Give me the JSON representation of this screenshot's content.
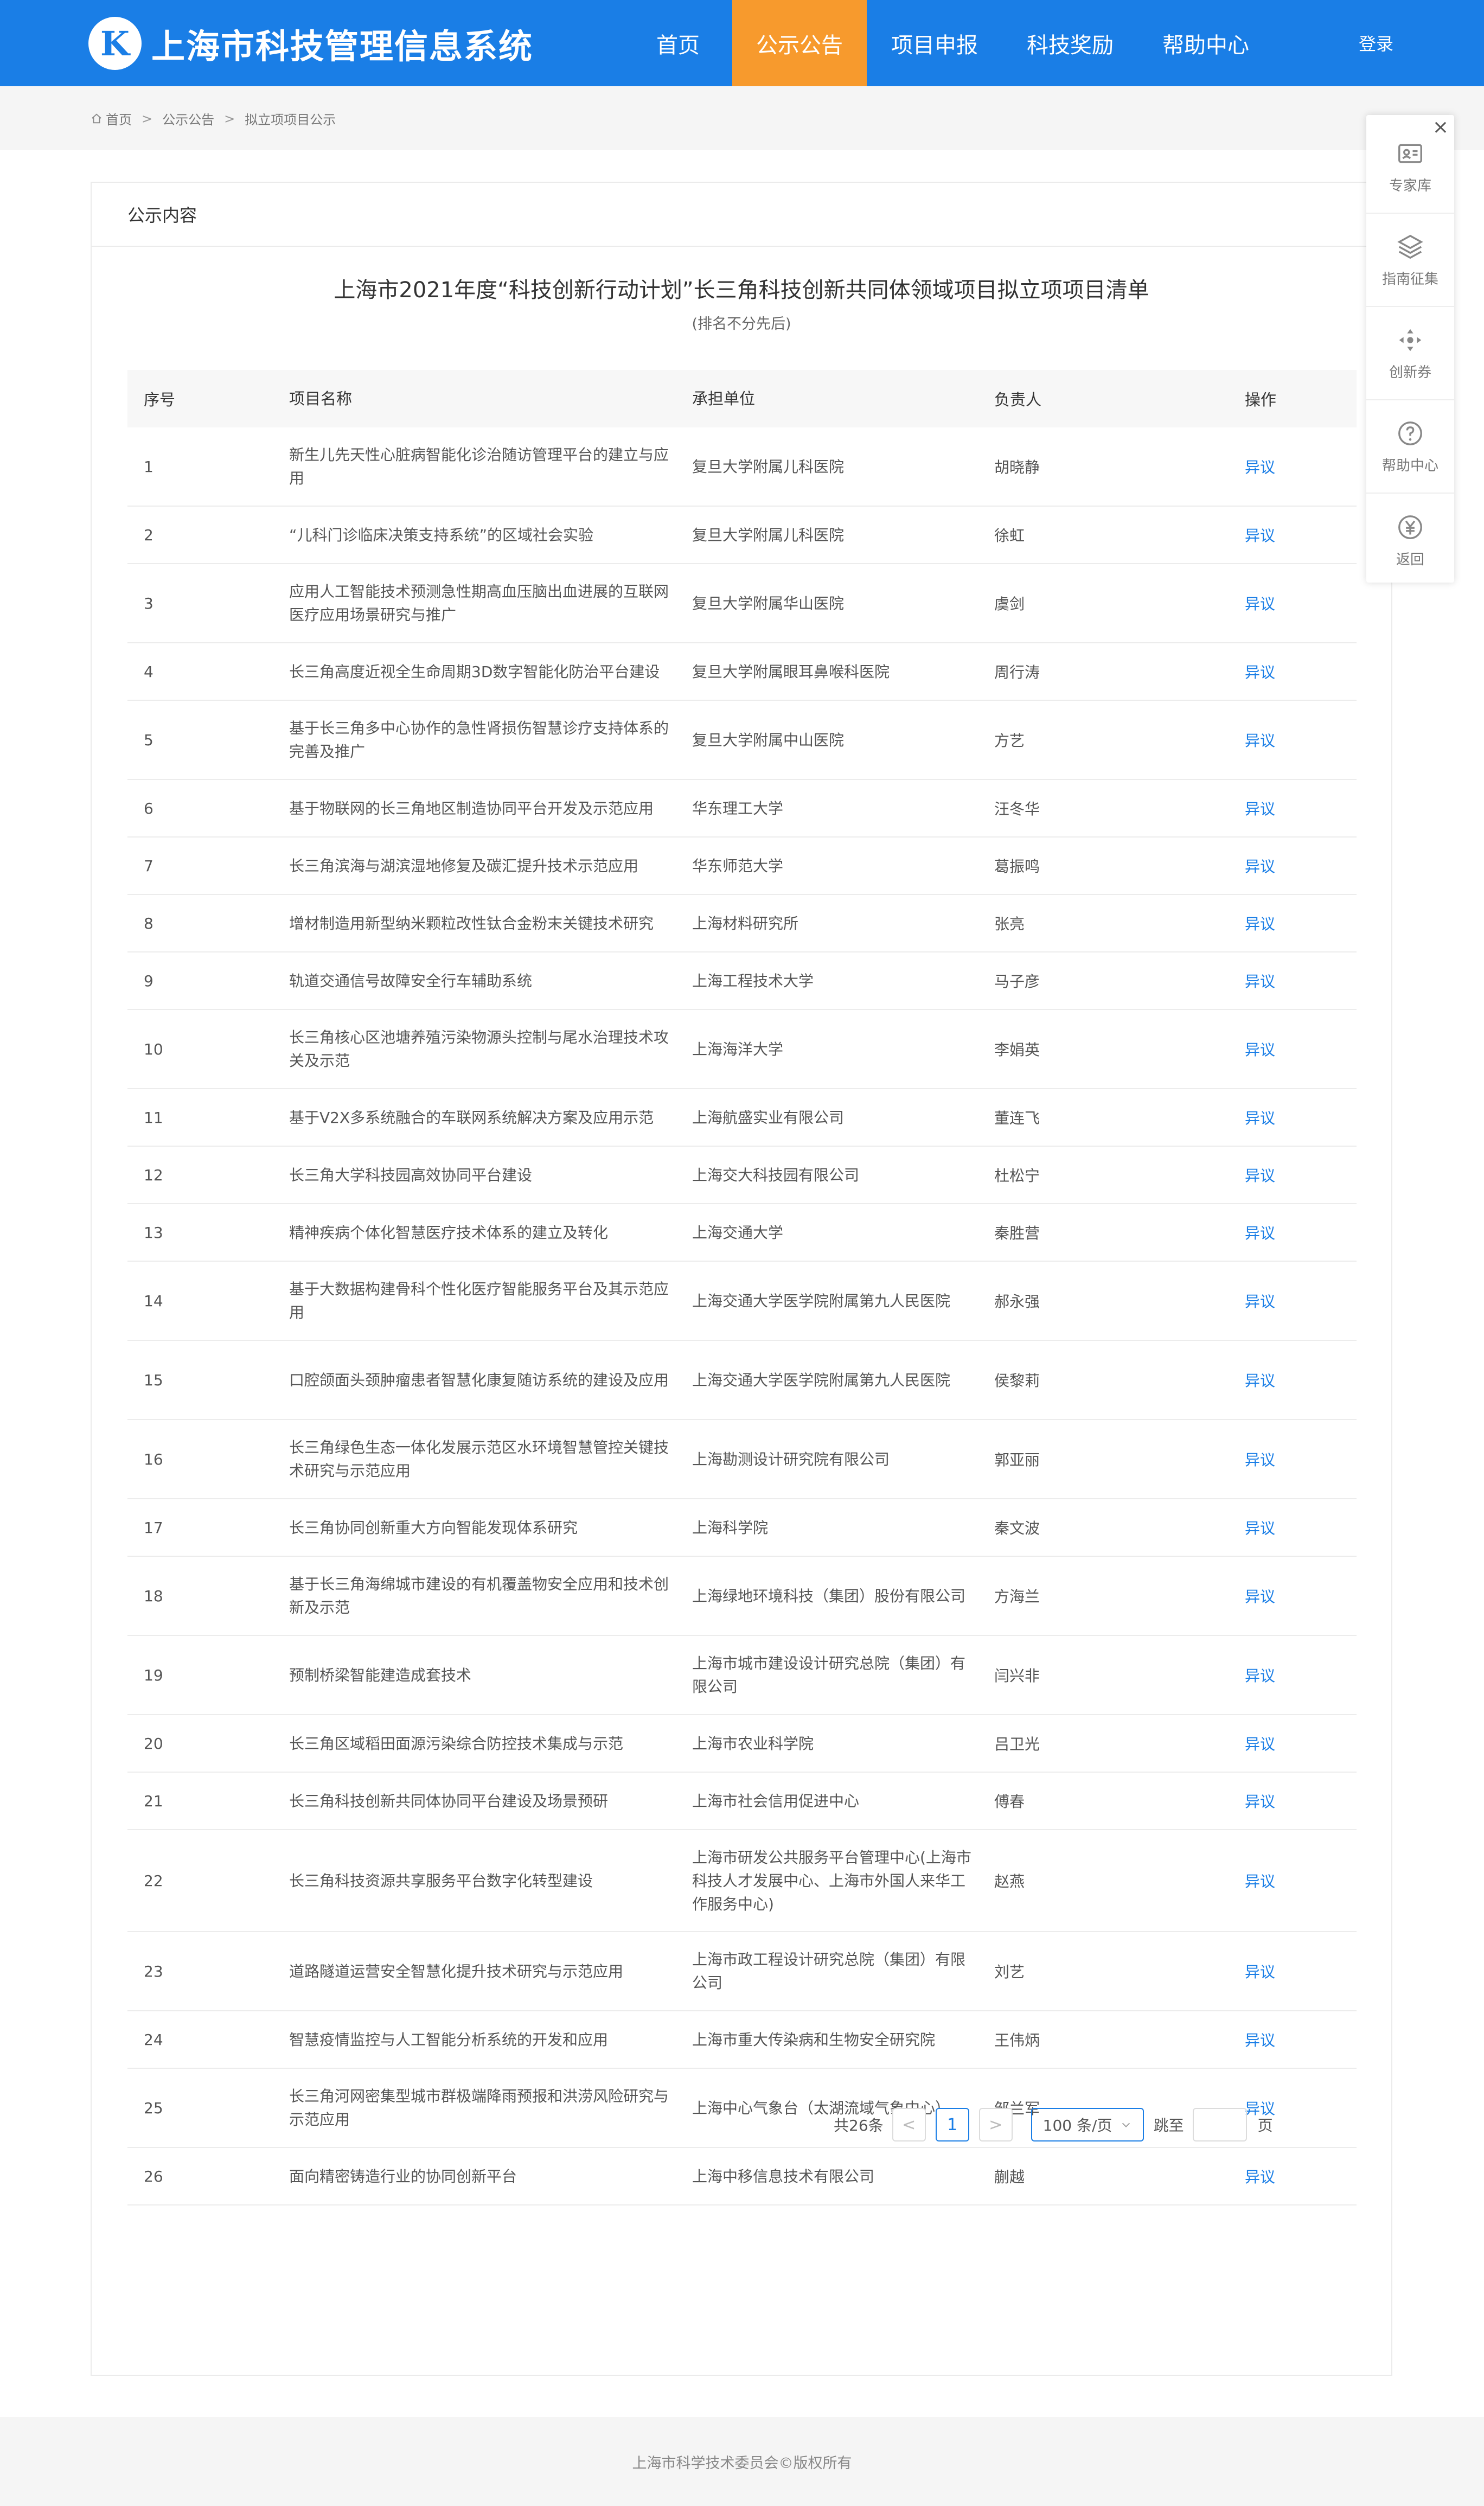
{
  "brand": {
    "mark": "K",
    "title": "上海市科技管理信息系统",
    "primary_color": "#1a7ee6",
    "accent_color": "#f79a2d"
  },
  "nav": [
    {
      "label": "首页"
    },
    {
      "label": "公示公告",
      "active": true
    },
    {
      "label": "项目申报"
    },
    {
      "label": "科技奖励"
    },
    {
      "label": "帮助中心"
    }
  ],
  "login_label": "登录",
  "breadcrumb": [
    "首页",
    "公示公告",
    "拟立项项目公示"
  ],
  "panel": {
    "heading": "公示内容",
    "doc_title": "上海市2021年度“科技创新行动计划”长三角科技创新共同体领域项目拟立项项目清单",
    "doc_subtitle": "(排名不分先后)"
  },
  "table": {
    "headers": [
      "序号",
      "项目名称",
      "承担单位",
      "负责人",
      "操作"
    ],
    "rows": [
      {
        "no": "1",
        "name": "新生儿先天性心脏病智能化诊治随访管理平台的建立与应用",
        "unit": "复旦大学附属儿科医院",
        "lead": "胡晓静",
        "op": "异议"
      },
      {
        "no": "2",
        "name": "“儿科门诊临床决策支持系统”的区域社会实验",
        "unit": "复旦大学附属儿科医院",
        "lead": "徐虹",
        "op": "异议"
      },
      {
        "no": "3",
        "name": "应用人工智能技术预测急性期高血压脑出血进展的互联网医疗应用场景研究与推广",
        "unit": "复旦大学附属华山医院",
        "lead": "虞剑",
        "op": "异议"
      },
      {
        "no": "4",
        "name": "长三角高度近视全生命周期3D数字智能化防治平台建设",
        "unit": "复旦大学附属眼耳鼻喉科医院",
        "lead": "周行涛",
        "op": "异议"
      },
      {
        "no": "5",
        "name": "基于长三角多中心协作的急性肾损伤智慧诊疗支持体系的完善及推广",
        "unit": "复旦大学附属中山医院",
        "lead": "方艺",
        "op": "异议"
      },
      {
        "no": "6",
        "name": "基于物联网的长三角地区制造协同平台开发及示范应用",
        "unit": "华东理工大学",
        "lead": "汪冬华",
        "op": "异议"
      },
      {
        "no": "7",
        "name": "长三角滨海与湖滨湿地修复及碳汇提升技术示范应用",
        "unit": "华东师范大学",
        "lead": "葛振鸣",
        "op": "异议"
      },
      {
        "no": "8",
        "name": "增材制造用新型纳米颗粒改性钛合金粉末关键技术研究",
        "unit": "上海材料研究所",
        "lead": "张亮",
        "op": "异议"
      },
      {
        "no": "9",
        "name": "轨道交通信号故障安全行车辅助系统",
        "unit": "上海工程技术大学",
        "lead": "马子彦",
        "op": "异议"
      },
      {
        "no": "10",
        "name": "长三角核心区池塘养殖污染物源头控制与尾水治理技术攻关及示范",
        "unit": "上海海洋大学",
        "lead": "李娟英",
        "op": "异议"
      },
      {
        "no": "11",
        "name": "基于V2X多系统融合的车联网系统解决方案及应用示范",
        "unit": "上海航盛实业有限公司",
        "lead": "董连飞",
        "op": "异议"
      },
      {
        "no": "12",
        "name": "长三角大学科技园高效协同平台建设",
        "unit": "上海交大科技园有限公司",
        "lead": "杜松宁",
        "op": "异议"
      },
      {
        "no": "13",
        "name": "精神疾病个体化智慧医疗技术体系的建立及转化",
        "unit": "上海交通大学",
        "lead": "秦胜营",
        "op": "异议"
      },
      {
        "no": "14",
        "name": "基于大数据构建骨科个性化医疗智能服务平台及其示范应用",
        "unit": "上海交通大学医学院附属第九人民医院",
        "lead": "郝永强",
        "op": "异议"
      },
      {
        "no": "15",
        "name": "口腔颌面头颈肿瘤患者智慧化康复随访系统的建设及应用",
        "unit": "上海交通大学医学院附属第九人民医院",
        "lead": "侯黎莉",
        "op": "异议"
      },
      {
        "no": "16",
        "name": "长三角绿色生态一体化发展示范区水环境智慧管控关键技术研究与示范应用",
        "unit": "上海勘测设计研究院有限公司",
        "lead": "郭亚丽",
        "op": "异议"
      },
      {
        "no": "17",
        "name": "长三角协同创新重大方向智能发现体系研究",
        "unit": "上海科学院",
        "lead": "秦文波",
        "op": "异议"
      },
      {
        "no": "18",
        "name": "基于长三角海绵城市建设的有机覆盖物安全应用和技术创新及示范",
        "unit": "上海绿地环境科技（集团）股份有限公司",
        "lead": "方海兰",
        "op": "异议"
      },
      {
        "no": "19",
        "name": "预制桥梁智能建造成套技术",
        "unit": "上海市城市建设设计研究总院（集团）有限公司",
        "lead": "闫兴非",
        "op": "异议"
      },
      {
        "no": "20",
        "name": "长三角区域稻田面源污染综合防控技术集成与示范",
        "unit": "上海市农业科学院",
        "lead": "吕卫光",
        "op": "异议"
      },
      {
        "no": "21",
        "name": "长三角科技创新共同体协同平台建设及场景预研",
        "unit": "上海市社会信用促进中心",
        "lead": "傅春",
        "op": "异议"
      },
      {
        "no": "22",
        "name": "长三角科技资源共享服务平台数字化转型建设",
        "unit": "上海市研发公共服务平台管理中心(上海市科技人才发展中心、上海市外国人来华工作服务中心)",
        "lead": "赵燕",
        "op": "异议"
      },
      {
        "no": "23",
        "name": "道路隧道运营安全智慧化提升技术研究与示范应用",
        "unit": "上海市政工程设计研究总院（集团）有限公司",
        "lead": "刘艺",
        "op": "异议"
      },
      {
        "no": "24",
        "name": "智慧疫情监控与人工智能分析系统的开发和应用",
        "unit": "上海市重大传染病和生物安全研究院",
        "lead": "王伟炳",
        "op": "异议"
      },
      {
        "no": "25",
        "name": "长三角河网密集型城市群极端降雨预报和洪涝风险研究与示范应用",
        "unit": "上海中心气象台（太湖流域气象中心）",
        "lead": "邹兰军",
        "op": "异议"
      },
      {
        "no": "26",
        "name": "面向精密铸造行业的协同创新平台",
        "unit": "上海中移信息技术有限公司",
        "lead": "蒯越",
        "op": "异议"
      }
    ]
  },
  "pagination": {
    "total": "共26条",
    "prev": "<",
    "current": "1",
    "next": ">",
    "page_size": "100 条/页",
    "jump_label": "跳至",
    "page_suffix": "页"
  },
  "float_toolbar": {
    "close": "×",
    "items": [
      {
        "label": "专家库",
        "icon": "id-card-icon"
      },
      {
        "label": "指南征集",
        "icon": "layers-icon"
      },
      {
        "label": "创新券",
        "icon": "move-icon"
      },
      {
        "label": "帮助中心",
        "icon": "question-icon"
      },
      {
        "label": "返回",
        "icon": "yuan-icon"
      }
    ]
  },
  "footer": "上海市科学技术委员会©版权所有"
}
